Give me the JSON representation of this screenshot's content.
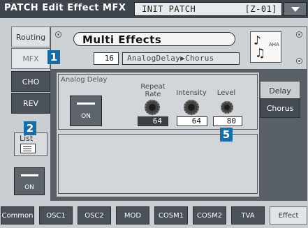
{
  "header": {
    "title": "PATCH Edit Effect MFX",
    "patch_name": "INIT PATCH",
    "patch_code": "[Z-01]",
    "menu_icon": "chevron-down-icon"
  },
  "left_tabs": [
    "Routing",
    "MFX",
    "CHO",
    "REV"
  ],
  "mfx": {
    "title": "Multi Effects",
    "type_number": "16",
    "type_name": "AnalogDelay▶Chorus",
    "icon_label": "AHA",
    "icon_name": "music-notes-icon"
  },
  "block": {
    "label": "Analog Delay",
    "on_label": "ON",
    "params": [
      {
        "name": "Repeat\nRate",
        "value": "64"
      },
      {
        "name": "Intensity",
        "value": "64"
      },
      {
        "name": "Level",
        "value": "80"
      }
    ]
  },
  "right_tabs": [
    "Delay",
    "Chorus"
  ],
  "list_button": {
    "label": "List"
  },
  "bottom_on_label": "ON",
  "bottom_tabs": [
    "Common",
    "OSC1",
    "OSC2",
    "MOD",
    "COSM1",
    "COSM2",
    "TVA",
    "Effect"
  ],
  "callouts": [
    "1",
    "2",
    "5"
  ],
  "colors": {
    "header": "#3f454c",
    "panel": "#5a6067",
    "callout": "#176ea7"
  }
}
